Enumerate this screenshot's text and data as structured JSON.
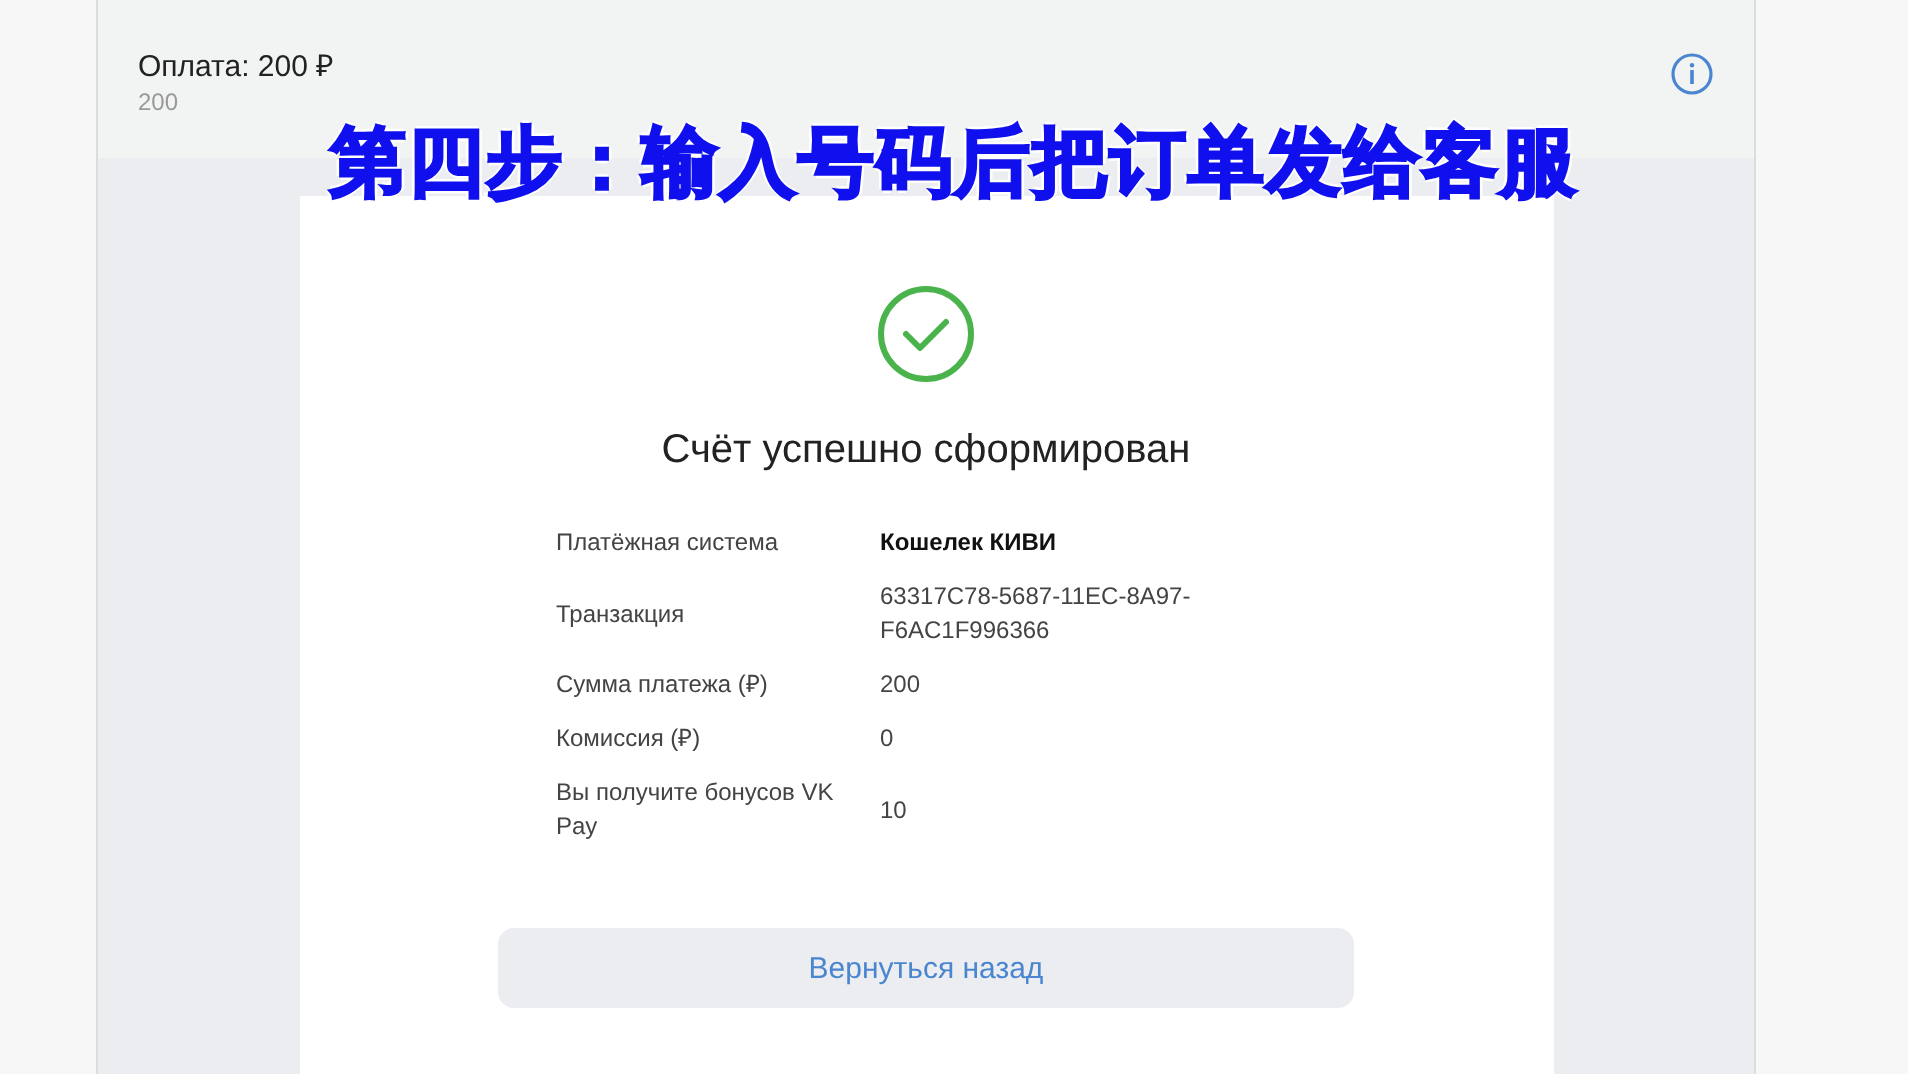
{
  "header": {
    "title": "Оплата: 200 ₽",
    "subtitle": "200"
  },
  "caption": "第四步：输入号码后把订单发给客服",
  "receipt": {
    "title": "Счёт успешно сформирован",
    "rows": [
      {
        "label": "Платёжная система",
        "value": "Кошелек КИВИ",
        "emphasis": true
      },
      {
        "label": "Транзакция",
        "value": "63317C78-5687-11EC-8A97-F6AC1F996366",
        "emphasis": false
      },
      {
        "label": "Сумма платежа (₽)",
        "value": "200",
        "emphasis": false
      },
      {
        "label": "Комиссия (₽)",
        "value": "0",
        "emphasis": false
      },
      {
        "label": "Вы получите бонусов VK Pay",
        "value": "10",
        "emphasis": false
      }
    ],
    "button": "Вернуться назад"
  }
}
